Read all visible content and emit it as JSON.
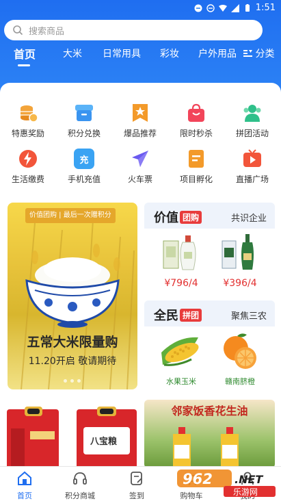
{
  "status": {
    "time": "1:51"
  },
  "search": {
    "placeholder": "搜索商品"
  },
  "tabs": [
    "首页",
    "大米",
    "日常用具",
    "彩妆",
    "户外用品"
  ],
  "category_button": "分类",
  "grid": [
    {
      "label": "特惠奖励",
      "icon": "coins-icon",
      "color": "#f3a43a"
    },
    {
      "label": "积分兑换",
      "icon": "store-icon",
      "color": "#3aa3f3"
    },
    {
      "label": "爆品推荐",
      "icon": "star-badge-icon",
      "color": "#f38a2a"
    },
    {
      "label": "限时秒杀",
      "icon": "shopping-bag-icon",
      "color": "#f2455a"
    },
    {
      "label": "拼团活动",
      "icon": "group-icon",
      "color": "#2fc08a"
    },
    {
      "label": "生活缴费",
      "icon": "lightning-icon",
      "color": "#f2553a"
    },
    {
      "label": "手机充值",
      "icon": "recharge-icon",
      "color": "#3aa3f3",
      "glyph": "充"
    },
    {
      "label": "火车票",
      "icon": "airplane-icon",
      "color": "#6a5af0"
    },
    {
      "label": "项目孵化",
      "icon": "document-icon",
      "color": "#f39a2a"
    },
    {
      "label": "直播广场",
      "icon": "live-tv-icon",
      "color": "#f2553a"
    }
  ],
  "promo": {
    "tag": "价值团购 | 最后一次赠积分",
    "title": "五常大米限量购",
    "subtitle": "11.20开启 敬请期待"
  },
  "card1": {
    "brand": "价值",
    "badge": "团购",
    "side": "共识企业",
    "items": [
      {
        "price": "¥796/4"
      },
      {
        "price": "¥396/4"
      }
    ]
  },
  "card2": {
    "brand": "全民",
    "badge": "拼团",
    "side": "聚焦三农",
    "items": [
      {
        "label": "水果玉米"
      },
      {
        "label": "赣南脐橙"
      }
    ]
  },
  "bottom": {
    "oil_banner": "邻家饭香花生油",
    "rice_bag": "八宝粮"
  },
  "tabbar": [
    {
      "label": "首页",
      "icon": "home-icon"
    },
    {
      "label": "积分商城",
      "icon": "headset-icon"
    },
    {
      "label": "签到",
      "icon": "sign-in-icon"
    },
    {
      "label": "购物车",
      "icon": "cart-icon"
    },
    {
      "label": "我的",
      "icon": "user-icon"
    }
  ],
  "watermark": {
    "brand": "962",
    "suffix": ".NET",
    "site": "乐游网"
  }
}
